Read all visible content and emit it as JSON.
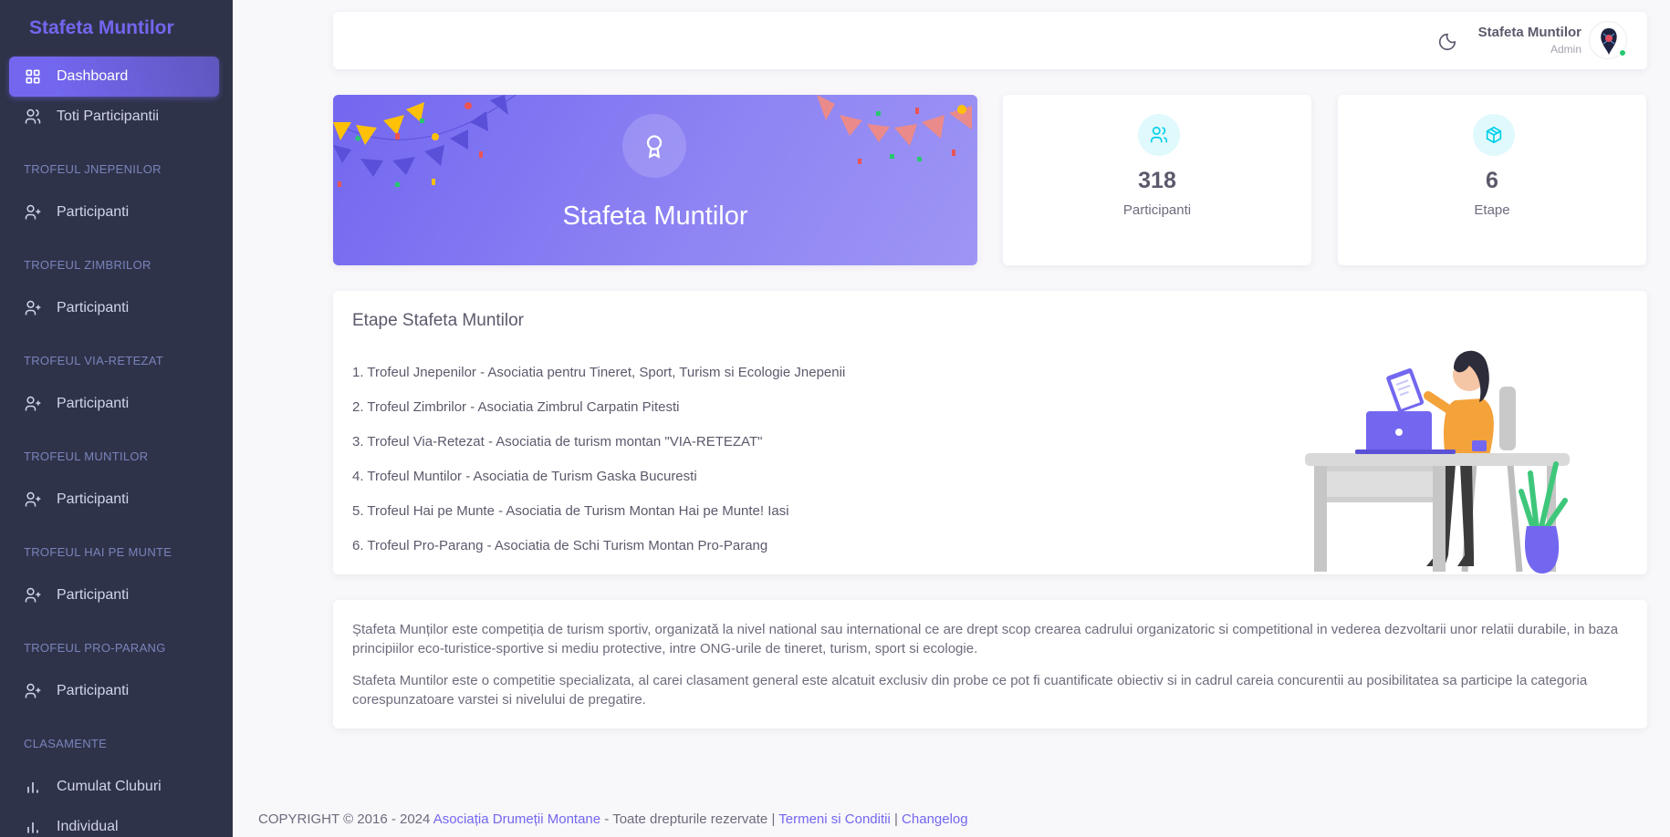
{
  "sidebar": {
    "brand": "Stafeta Muntilor",
    "dashboard": "Dashboard",
    "all_participants": "Toti Participantii",
    "sections": [
      {
        "header": "TROFEUL JNEPENILOR",
        "item": "Participanti"
      },
      {
        "header": "TROFEUL ZIMBRILOR",
        "item": "Participanti"
      },
      {
        "header": "TROFEUL VIA-RETEZAT",
        "item": "Participanti"
      },
      {
        "header": "TROFEUL MUNTILOR",
        "item": "Participanti"
      },
      {
        "header": "TROFEUL HAI PE MUNTE",
        "item": "Participanti"
      },
      {
        "header": "TROFEUL PRO-PARANG",
        "item": "Participanti"
      }
    ],
    "rankings_header": "CLASAMENTE",
    "rankings": [
      "Cumulat Cluburi",
      "Individual"
    ]
  },
  "topbar": {
    "user_name": "Stafeta Muntilor",
    "user_role": "Admin",
    "icons": {
      "theme": "moon-icon",
      "avatar": "avatar"
    }
  },
  "hero": {
    "title": "Stafeta Muntilor"
  },
  "stats": [
    {
      "value": "318",
      "label": "Participanti",
      "icon": "users-icon"
    },
    {
      "value": "6",
      "label": "Etape",
      "icon": "box-icon"
    }
  ],
  "stages": {
    "title": "Etape Stafeta Muntilor",
    "items": [
      "1. Trofeul Jnepenilor - Asociatia pentru Tineret, Sport, Turism si Ecologie Jnepenii",
      "2. Trofeul Zimbrilor - Asociatia Zimbrul Carpatin Pitesti",
      "3. Trofeul Via-Retezat - Asociatia de turism montan \"VIA-RETEZAT\"",
      "4. Trofeul Muntilor - Asociatia de Turism Gaska Bucuresti",
      "5. Trofeul Hai pe Munte - Asociatia de Turism Montan Hai pe Munte! Iasi",
      "6. Trofeul Pro-Parang - Asociatia de Schi Turism Montan Pro-Parang"
    ]
  },
  "about": {
    "p1": "Ștafeta Munților este competiția de turism sportiv, organizată la nivel national sau international ce are drept scop crearea cadrului organizatoric si competitional in vederea dezvoltarii unor relatii durabile, in baza principiilor eco-turistice-sportive si mediu protective, intre ONG-urile de tineret, turism, sport si ecologie.",
    "p2": "Stafeta Muntilor este o competitie specializata, al carei clasament general este alcatuit exclusiv din probe ce pot fi cuantificate obiectiv si in cadrul careia concurentii au posibilitatea sa participe la categoria corespunzatoare varstei si nivelului de pregatire."
  },
  "footer": {
    "copyright": "COPYRIGHT © 2016 - 2024",
    "org": "Asociația Drumeții Montane",
    "rights": "- Toate drepturile rezervate |",
    "terms": "Termeni si Conditii",
    "sep": "|",
    "changelog": "Changelog"
  },
  "colors": {
    "primary": "#7367f0",
    "sidebar": "#2f3349",
    "info": "#00cfe8",
    "success": "#28c76f"
  }
}
